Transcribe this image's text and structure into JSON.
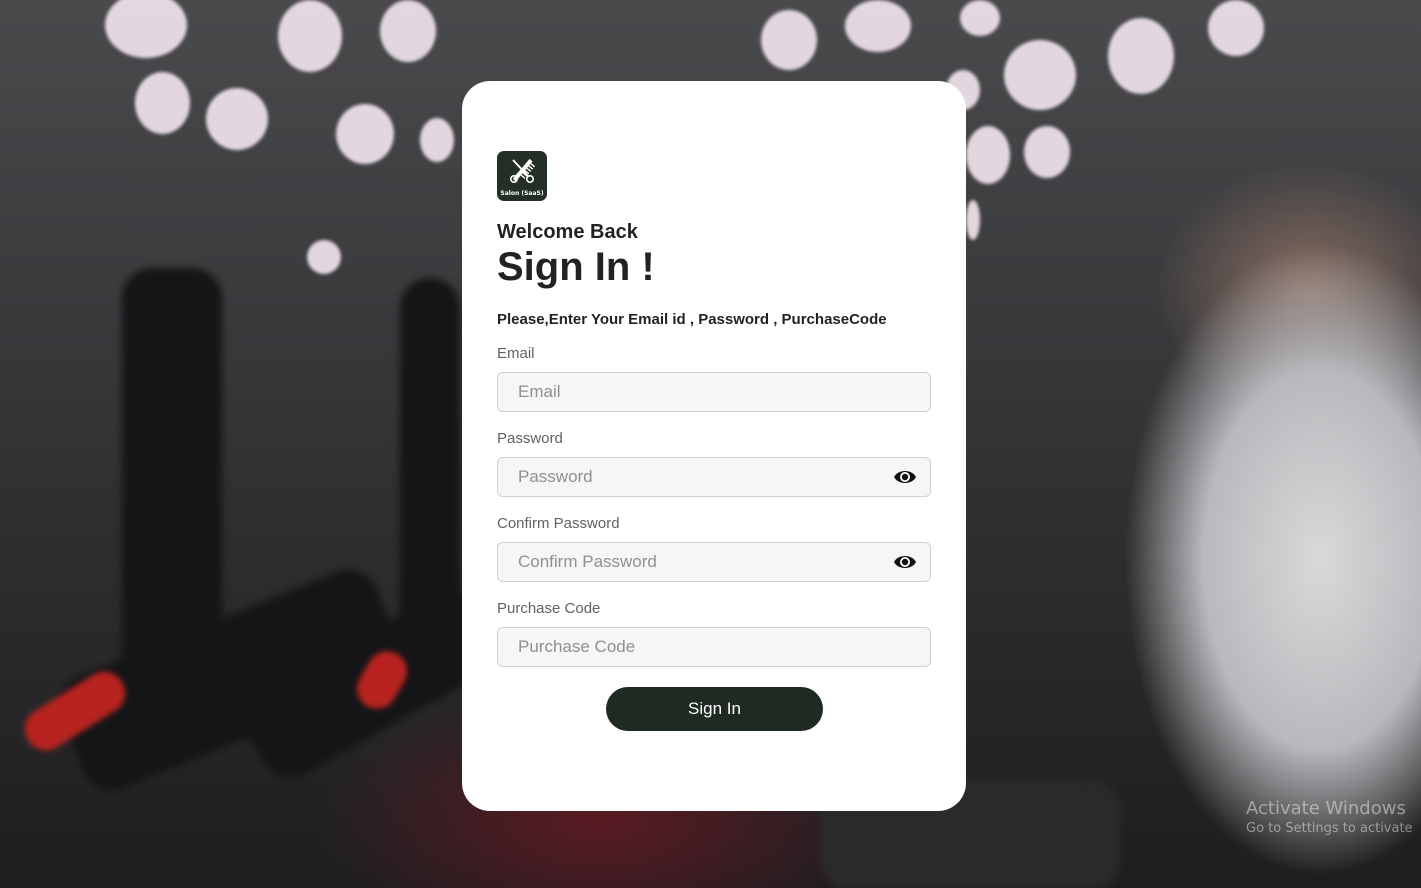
{
  "logo": {
    "icon": "scissors-comb-icon",
    "text": "Salon (SaaS)"
  },
  "welcome": "Welcome Back",
  "title": "Sign In !",
  "instruction": "Please,Enter Your Email id , Password , PurchaseCode",
  "fields": {
    "email": {
      "label": "Email",
      "placeholder": "Email",
      "value": ""
    },
    "password": {
      "label": "Password",
      "placeholder": "Password",
      "value": "",
      "icon": "eye-icon"
    },
    "confirm_password": {
      "label": "Confirm Password",
      "placeholder": "Confirm Password",
      "value": "",
      "icon": "eye-icon"
    },
    "purchase_code": {
      "label": "Purchase Code",
      "placeholder": "Purchase Code",
      "value": ""
    }
  },
  "submit_label": "Sign In",
  "watermark": {
    "line1": "Activate Windows",
    "line2": "Go to Settings to activate"
  },
  "colors": {
    "brand_dark": "#1f2a22",
    "card": "#ffffff",
    "input_bg": "#f6f6f6"
  }
}
